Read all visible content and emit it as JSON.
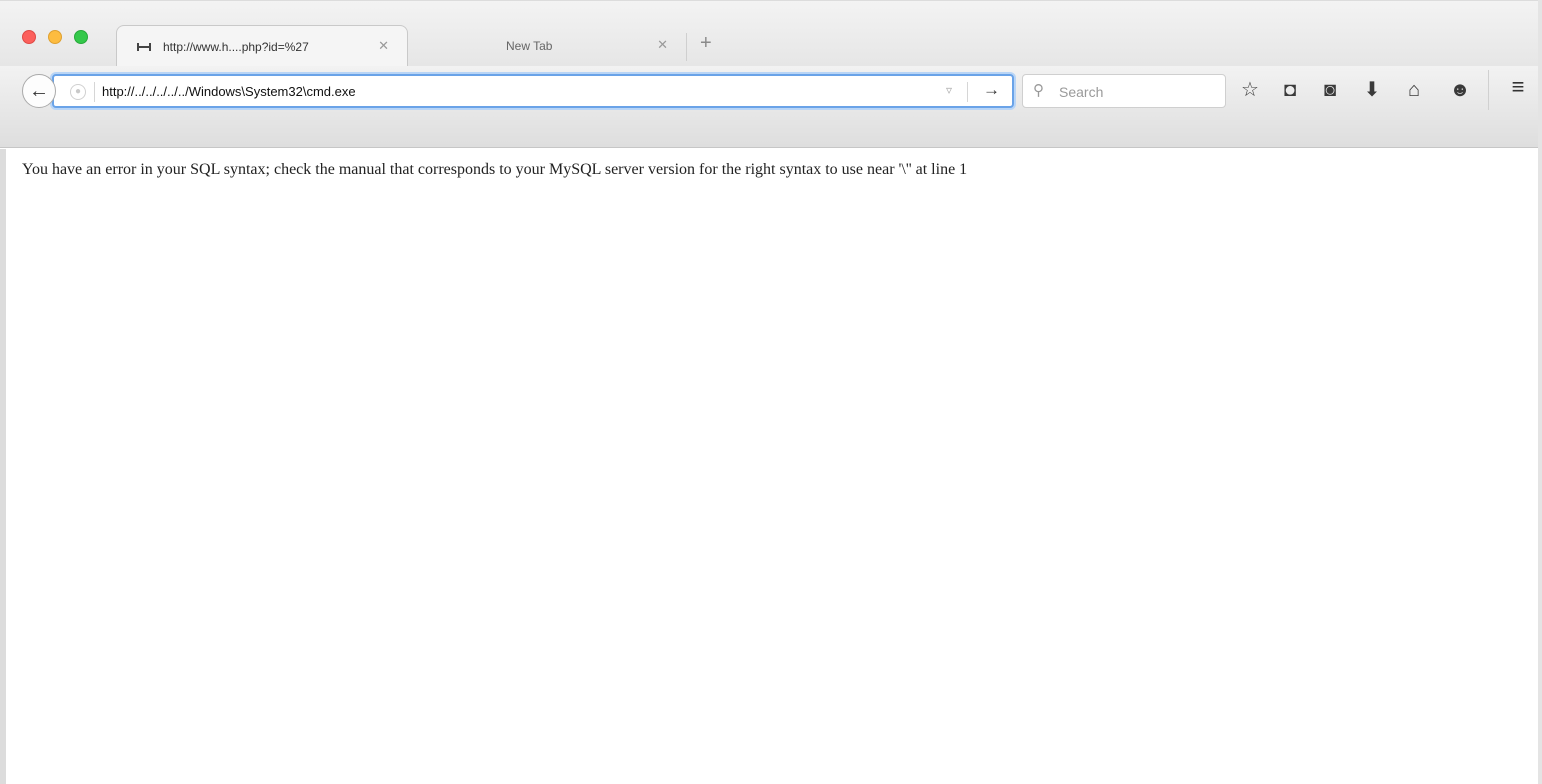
{
  "tabs": [
    {
      "title": "http://www.h....php?id=%27",
      "close": "✕",
      "active": true
    },
    {
      "title": "New Tab",
      "close": "✕",
      "active": false
    }
  ],
  "new_tab_symbol": "+",
  "nav": {
    "back_symbol": "←",
    "url": "http://../../../../../Windows\\System32\\cmd.exe",
    "go_symbol": "→",
    "dropdown_symbol": "▿"
  },
  "search": {
    "placeholder": "Search",
    "icon_symbol": "⚲"
  },
  "toolbar_icons": [
    {
      "name": "bookmark-star-icon",
      "symbol": "☆"
    },
    {
      "name": "reading-list-icon",
      "symbol": "◘"
    },
    {
      "name": "pocket-icon",
      "symbol": "◙"
    },
    {
      "name": "downloads-icon",
      "symbol": "⬇"
    },
    {
      "name": "home-icon",
      "symbol": "⌂"
    },
    {
      "name": "hello-chat-icon",
      "symbol": "☻"
    }
  ],
  "menu_symbol": "≡",
  "page": {
    "error_message": "You have an error in your SQL syntax; check the manual that corresponds to your MySQL server version for the right syntax to use near '\\'' at line 1"
  }
}
